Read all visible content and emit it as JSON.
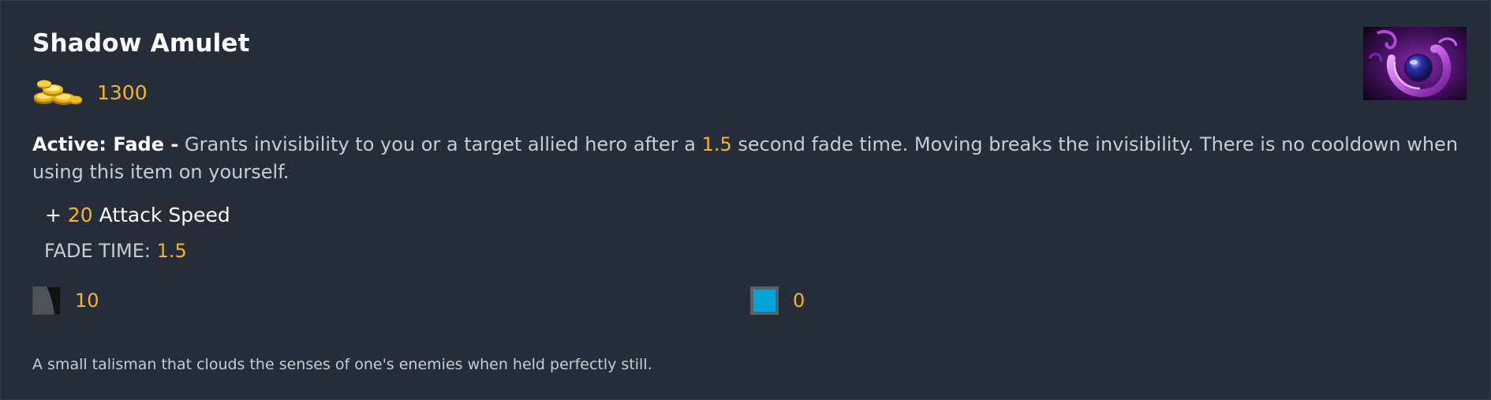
{
  "item": {
    "name": "Shadow Amulet",
    "cost": "1300",
    "icon": "shadow-amulet-item-image",
    "gold_icon": "gold-coins-icon"
  },
  "active": {
    "label": "Active: Fade -",
    "text_1": " Grants invisibility to you or a target allied hero after a ",
    "fade_value": "1.5",
    "text_2": " second fade time. Moving breaks the invisibility. There is no cooldown when using this item on yourself."
  },
  "stats": {
    "prefix": "+ ",
    "attack_speed_value": "20",
    "attack_speed_label": " Attack Speed",
    "fade_time_label": "FADE TIME: ",
    "fade_time_value": "1.5"
  },
  "costs": {
    "cooldown_icon": "cooldown-icon",
    "cooldown": "10",
    "mana_icon": "mana-cost-icon",
    "mana": "0"
  },
  "lore": "A small talisman that clouds the senses of one's enemies when held perfectly still.",
  "colors": {
    "background": "#252e38",
    "gold": "#f4b232",
    "mana": "#00a4db",
    "title": "#ffffff",
    "text": "#c9ccd0"
  }
}
